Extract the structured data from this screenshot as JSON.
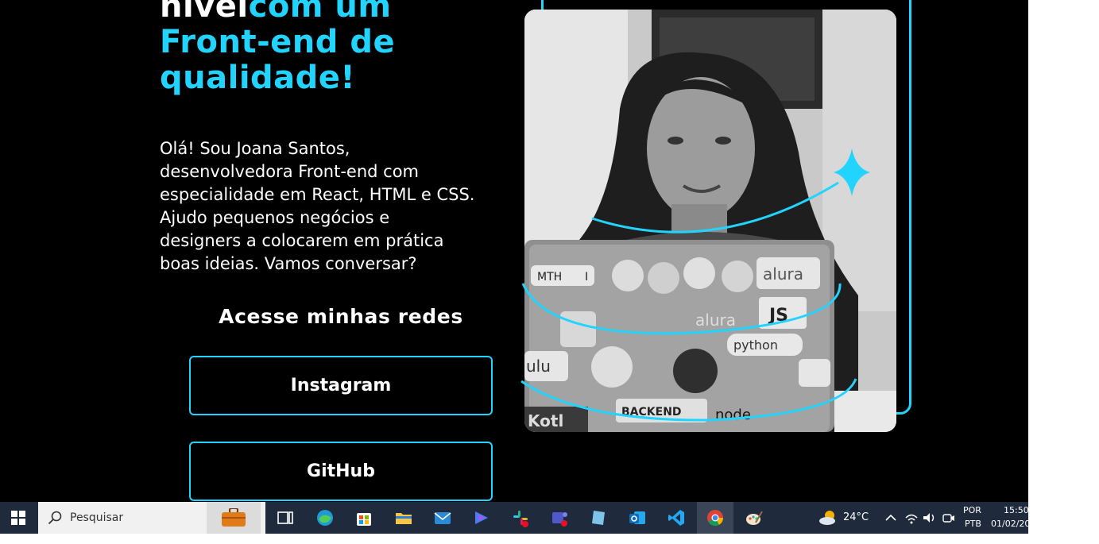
{
  "hero": {
    "title_white": "nível",
    "title_blue_1": "com um",
    "title_blue_2": "Front-end de",
    "title_blue_3": "qualidade!",
    "paragraph_lines": [
      "Olá! Sou Joana Santos,",
      "desenvolvedora Front-end com",
      "especialidade em React, HTML e CSS.",
      "Ajudo pequenos negócios e",
      "designers a colocarem em prática",
      "boas ideias. Vamos conversar?"
    ]
  },
  "social": {
    "title": "Acesse minhas redes",
    "instagram_label": "Instagram",
    "github_label": "GitHub"
  },
  "photo": {
    "sticker_texts": [
      "MTH",
      "I",
      "alura",
      "JS",
      "alura",
      "python",
      "BACKEND",
      "node",
      "ulu",
      "Kotl"
    ]
  },
  "colors": {
    "accent": "#22d4fd",
    "background": "#000000",
    "text": "#ffffff",
    "taskbar": "#1f2a3c"
  },
  "taskbar": {
    "search_placeholder": "Pesquisar",
    "weather_temp": "24°C",
    "language_1": "POR",
    "language_2": "PTB",
    "time": "15:50",
    "date": "01/02/20",
    "icons": [
      "windows-start-icon",
      "search-icon",
      "briefcase-icon",
      "task-view-icon",
      "edge-icon",
      "store-icon",
      "file-explorer-icon",
      "mail-icon",
      "copilot-icon",
      "slack-icon",
      "teams-icon",
      "notes-icon",
      "outlook-icon",
      "vscode-icon",
      "chrome-icon",
      "paint-icon",
      "weather-icon",
      "chevron-up-icon",
      "wifi-icon",
      "volume-icon",
      "meet-icon"
    ]
  }
}
